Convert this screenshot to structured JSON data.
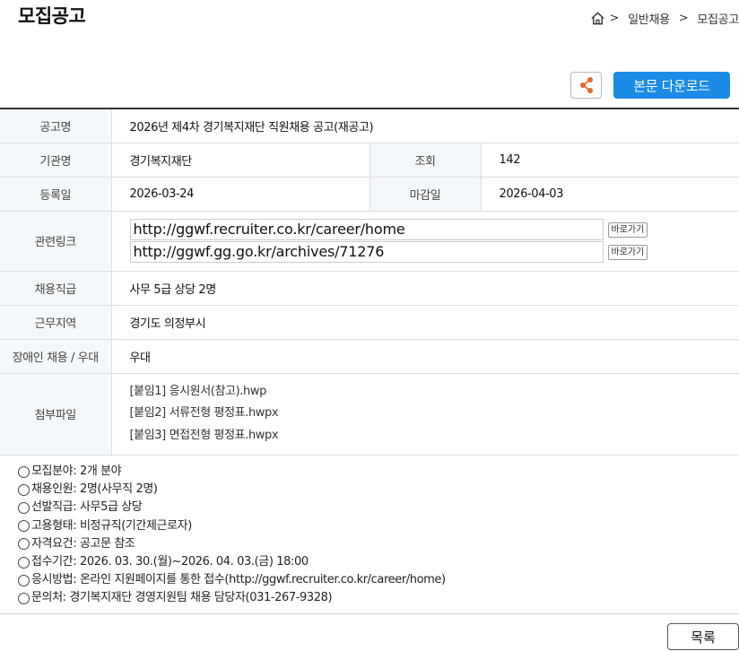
{
  "page": {
    "title": "모집공고"
  },
  "breadcrumb": {
    "sep1": ">",
    "item1": "일반채용",
    "sep2": ">",
    "item2": "모집공고"
  },
  "toolbar": {
    "download_label": "본문 다운로드"
  },
  "table": {
    "title_label": "공고명",
    "title_value": "2026년 제4차 경기복지재단 직원채용 공고(재공고)",
    "org_label": "기관명",
    "org_value": "경기복지재단",
    "views_label": "조회",
    "views_value": "142",
    "reg_label": "등록일",
    "reg_value": "2026-03-24",
    "deadline_label": "마감일",
    "deadline_value": "2026-04-03",
    "links_label": "관련링크",
    "links": [
      {
        "url": "http://ggwf.recruiter.co.kr/career/home",
        "button": "바로가기"
      },
      {
        "url": "http://ggwf.gg.go.kr/archives/71276",
        "button": "바로가기"
      }
    ],
    "position_label": "채용직급",
    "position_value": "사무 5급 상당 2명",
    "location_label": "근무지역",
    "location_value": "경기도 의정부시",
    "disabled_label": "장애인 채용 / 우대",
    "disabled_value": "우대",
    "files_label": "첨부파일",
    "files": [
      "[붙임1] 응시원서(참고).hwp",
      "[붙임2] 서류전형 평정표.hwpx",
      "[붙임3] 면접전형 평정표.hwpx"
    ]
  },
  "summary": [
    "모집분야: 2개 분야",
    "채용인원: 2명(사무직 2명)",
    "선발직급: 사무5급 상당",
    "고용형태: 비정규직(기간제근로자)",
    "자격요건: 공고문 참조",
    "접수기간: 2026. 03. 30.(월)~2026. 04. 03.(금) 18:00",
    "응시방법: 온라인 지원페이지를 통한 접수(http://ggwf.recruiter.co.kr/career/home)",
    "문의처: 경기복지재단 경영지원팀 채용 담당자(031-267-9328)"
  ],
  "footer": {
    "list_label": "목록"
  },
  "colors": {
    "accent": "#1b8be6",
    "share_icon": "#e8632b"
  },
  "icons": {
    "home": "home-icon",
    "share": "share-icon",
    "bullet": "circle-icon"
  }
}
